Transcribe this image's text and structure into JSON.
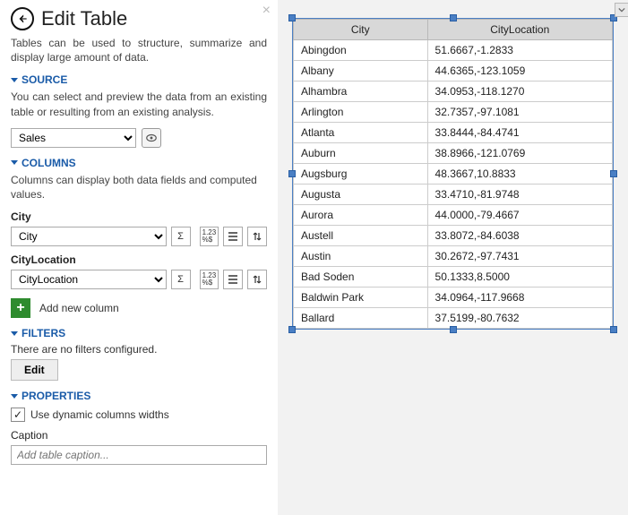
{
  "panel": {
    "title": "Edit Table",
    "intro": "Tables can be used to structure, summarize and display large amount of data.",
    "source": {
      "heading": "SOURCE",
      "desc": "You can select and preview the data from an existing table or resulting from an existing analysis.",
      "value": "Sales"
    },
    "columns": {
      "heading": "COLUMNS",
      "desc": "Columns can display both data fields and computed values.",
      "items": [
        {
          "label": "City",
          "value": "City"
        },
        {
          "label": "CityLocation",
          "value": "CityLocation"
        }
      ],
      "add_label": "Add new column"
    },
    "filters": {
      "heading": "FILTERS",
      "empty": "There are no filters configured.",
      "edit_label": "Edit"
    },
    "properties": {
      "heading": "PROPERTIES",
      "dynamic_label": "Use dynamic columns widths",
      "dynamic_checked": true,
      "caption_label": "Caption",
      "caption_placeholder": "Add table caption..."
    }
  },
  "table": {
    "headers": [
      "City",
      "CityLocation"
    ],
    "rows": [
      [
        "Abingdon",
        "51.6667,-1.2833"
      ],
      [
        "Albany",
        "44.6365,-123.1059"
      ],
      [
        "Alhambra",
        "34.0953,-118.1270"
      ],
      [
        "Arlington",
        "32.7357,-97.1081"
      ],
      [
        "Atlanta",
        "33.8444,-84.4741"
      ],
      [
        "Auburn",
        "38.8966,-121.0769"
      ],
      [
        "Augsburg",
        "48.3667,10.8833"
      ],
      [
        "Augusta",
        "33.4710,-81.9748"
      ],
      [
        "Aurora",
        "44.0000,-79.4667"
      ],
      [
        "Austell",
        "33.8072,-84.6038"
      ],
      [
        "Austin",
        "30.2672,-97.7431"
      ],
      [
        "Bad Soden",
        "50.1333,8.5000"
      ],
      [
        "Baldwin Park",
        "34.0964,-117.9668"
      ],
      [
        "Ballard",
        "37.5199,-80.7632"
      ]
    ]
  }
}
